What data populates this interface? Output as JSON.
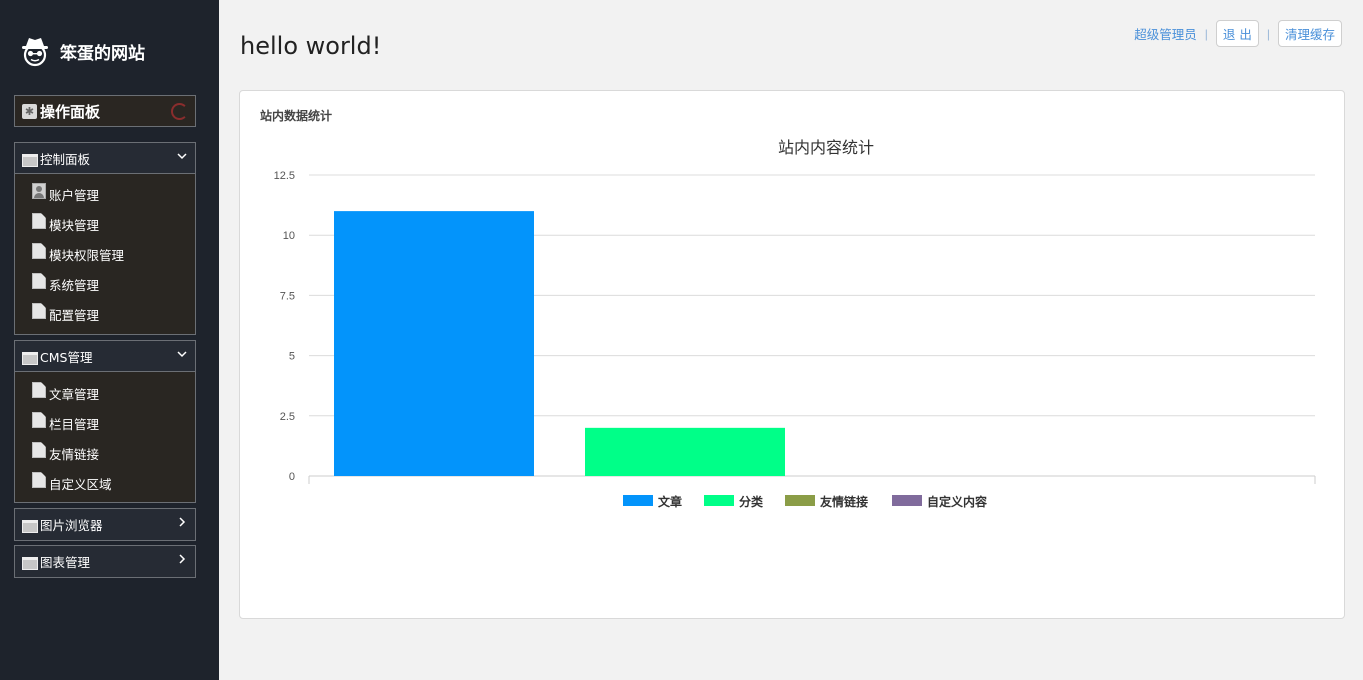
{
  "sidebar": {
    "brand": "笨蛋的网站",
    "op_panel": "操作面板",
    "groups": [
      {
        "label": "控制面板",
        "items": [
          "账户管理",
          "模块管理",
          "模块权限管理",
          "系统管理",
          "配置管理"
        ]
      },
      {
        "label": "CMS管理",
        "items": [
          "文章管理",
          "栏目管理",
          "友情链接",
          "自定义区域"
        ]
      },
      {
        "label": "图片浏览器"
      },
      {
        "label": "图表管理"
      }
    ]
  },
  "header": {
    "title": "hello world!",
    "user": "超级管理员",
    "logout": "退 出",
    "clear_cache": "清理缓存"
  },
  "panel": {
    "title": "站内数据统计"
  },
  "chart_data": {
    "type": "bar",
    "title": "站内内容统计",
    "series": [
      {
        "name": "文章",
        "value": 11,
        "color": "#0394fb"
      },
      {
        "name": "分类",
        "value": 2,
        "color": "#00ff88"
      },
      {
        "name": "友情链接",
        "value": 0,
        "color": "#8b9d47"
      },
      {
        "name": "自定义内容",
        "value": 0,
        "color": "#806b9c"
      }
    ],
    "yticks": [
      "0",
      "2.5",
      "5",
      "7.5",
      "10",
      "12.5"
    ],
    "ylim": [
      0,
      12.5
    ],
    "grid": true,
    "legend": "bottom"
  }
}
